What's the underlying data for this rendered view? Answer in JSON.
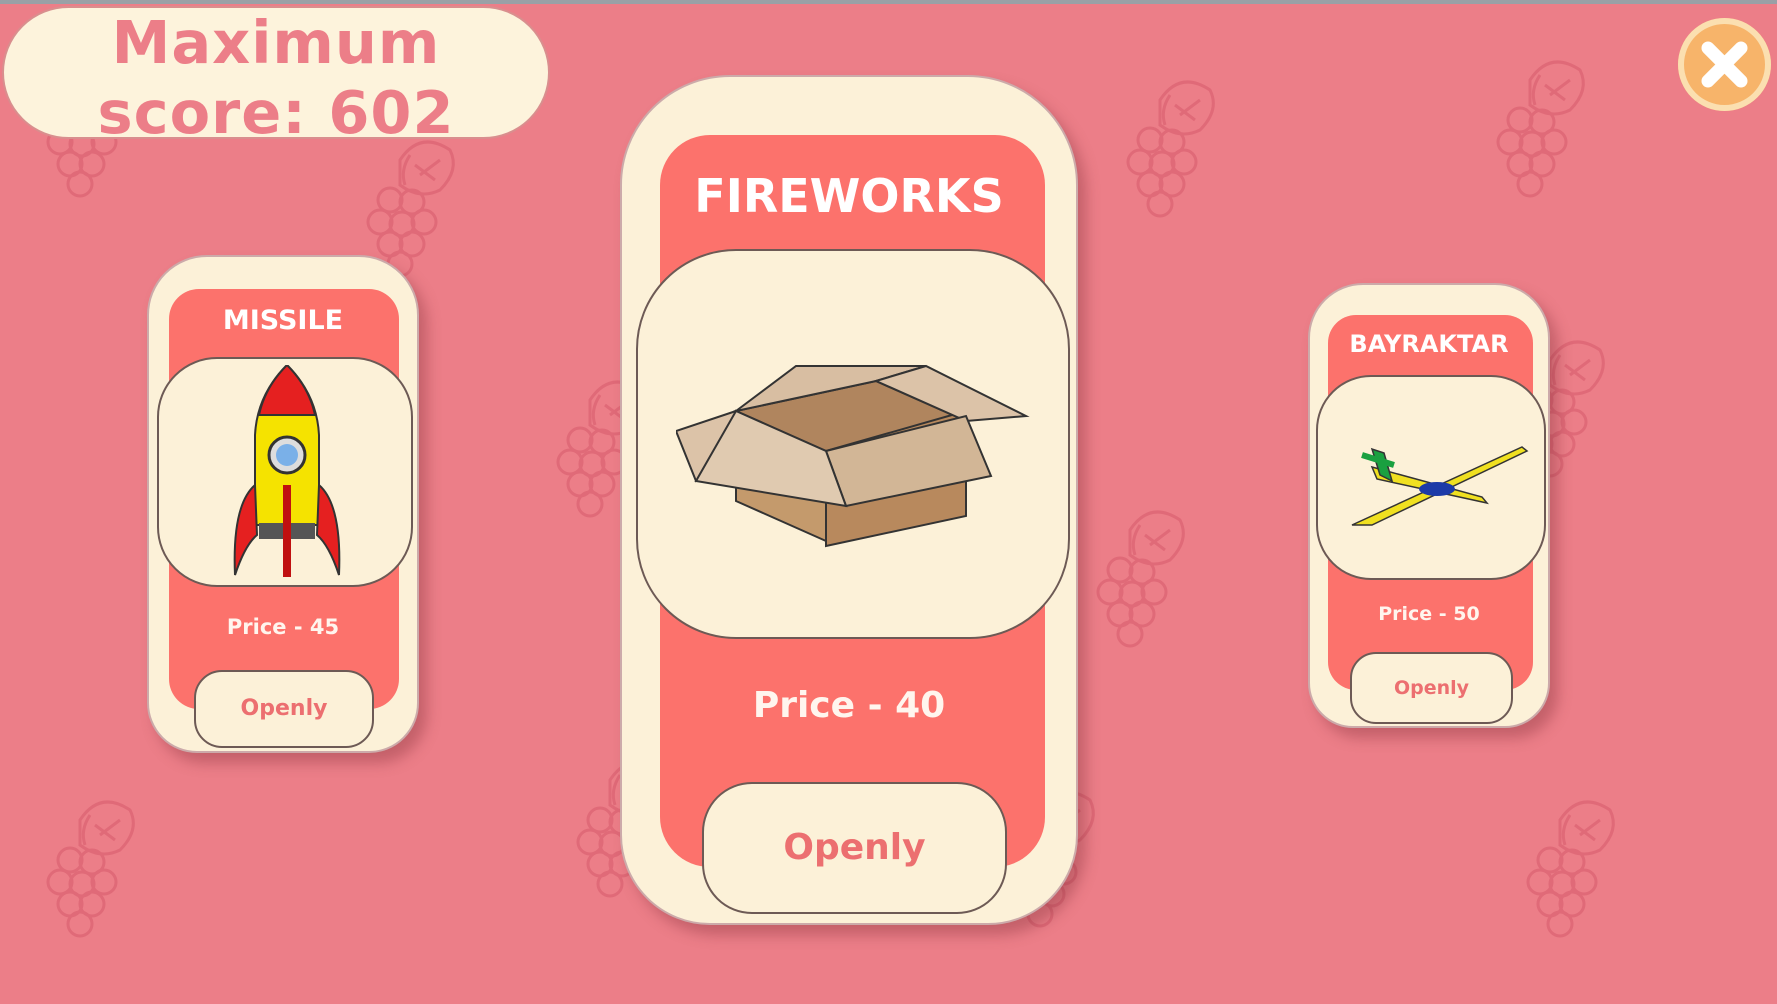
{
  "score": {
    "line1": "Maximum",
    "line2": "score: 602"
  },
  "close": {
    "icon": "close-icon"
  },
  "cards": {
    "missile": {
      "title": "MISSILE",
      "price": "Price - 45",
      "button": "Openly",
      "icon": "rocket-icon"
    },
    "fireworks": {
      "title": "FIREWORKS",
      "price": "Price - 40",
      "button": "Openly",
      "icon": "box-icon"
    },
    "bayraktar": {
      "title": "BAYRAKTAR",
      "price": "Price - 50",
      "button": "Openly",
      "icon": "drone-icon"
    }
  },
  "colors": {
    "background": "#ec7e88",
    "card": "#fcf1d8",
    "band": "#fc726c",
    "close": "#f7b46a"
  }
}
